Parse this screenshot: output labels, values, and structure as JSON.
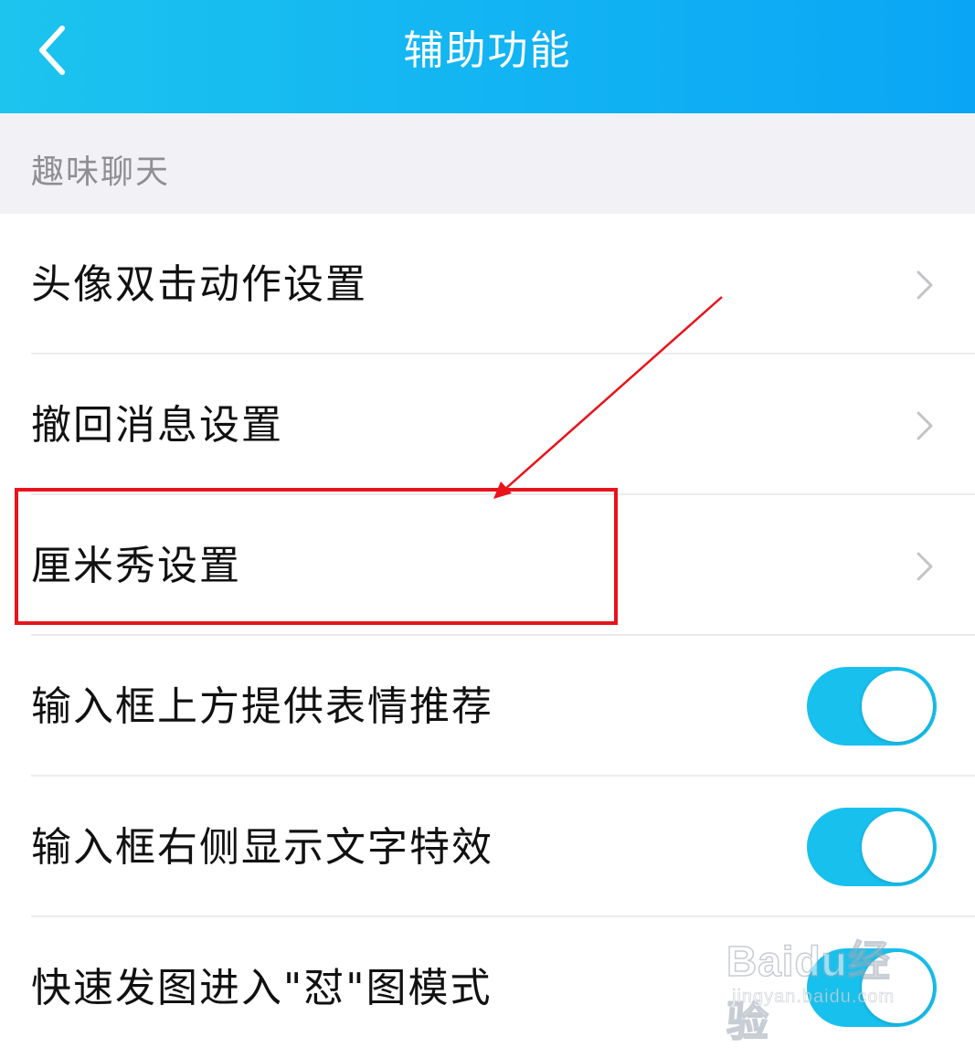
{
  "header": {
    "title": "辅助功能",
    "back_icon": "chevron-left-icon"
  },
  "section": {
    "label": "趣味聊天"
  },
  "items": [
    {
      "label": "头像双击动作设置",
      "control": "chevron-right-icon"
    },
    {
      "label": "撤回消息设置",
      "control": "chevron-right-icon"
    },
    {
      "label": "厘米秀设置",
      "control": "chevron-right-icon"
    },
    {
      "label": "输入框上方提供表情推荐",
      "control": "toggle",
      "checked": true
    },
    {
      "label": "输入框右侧显示文字特效",
      "control": "toggle",
      "checked": true
    },
    {
      "label": "快速发图进入\"怼\"图模式",
      "control": "toggle",
      "checked": true
    }
  ],
  "watermark": {
    "logo": "Baidu经验",
    "sub": "jingyan.baidu.com"
  },
  "colors": {
    "header_gradient_start": "#1cc4ee",
    "header_gradient_end": "#0aa6f5",
    "toggle_on": "#18c0ee",
    "annotation_red": "#e8131b",
    "section_text": "#8e8e93"
  }
}
